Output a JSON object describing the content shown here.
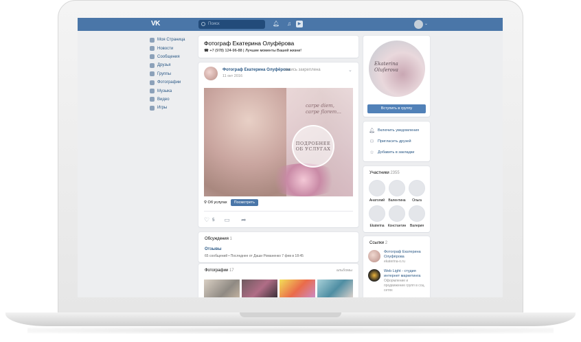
{
  "header": {
    "logo": "VK",
    "search_placeholder": "Поиск",
    "icons": [
      "bell-icon",
      "music-icon",
      "play-icon"
    ]
  },
  "nav": {
    "items": [
      {
        "label": "Моя Страница",
        "icon": "home-icon"
      },
      {
        "label": "Новости",
        "icon": "news-icon"
      },
      {
        "label": "Сообщения",
        "icon": "messages-icon"
      },
      {
        "label": "Друзья",
        "icon": "friends-icon"
      },
      {
        "label": "Группы",
        "icon": "groups-icon"
      },
      {
        "label": "Фотографии",
        "icon": "photos-icon"
      },
      {
        "label": "Музыка",
        "icon": "music-icon"
      },
      {
        "label": "Видео",
        "icon": "video-icon"
      },
      {
        "label": "Игры",
        "icon": "games-icon"
      }
    ]
  },
  "group": {
    "name": "Фотограф Екатерина Олуфёрова",
    "status": "☎ +7 (978) 124-96-88 | Лучшие моменты Вашей жизни!"
  },
  "post": {
    "author": "Фотограф Екатерина Олуфёрова",
    "pinned": "запись закреплена",
    "date": "11 окт 2016",
    "image_script": "carpe diem,\ncarpe florem...",
    "image_badge": "ПОДРОБНЕЕ\nОБ УСЛУГАХ",
    "link_label": "⚲ Об услугах",
    "link_button": "Посмотреть",
    "likes": "5"
  },
  "discussions": {
    "title": "Обсуждения",
    "count": "1",
    "topic": "Отзывы",
    "meta": "65 сообщений  •  Последнее от Даши Романенко 7 фев в 18:45"
  },
  "photos": {
    "title": "Фотографии",
    "count": "17",
    "albums": "альбомы"
  },
  "sidebar": {
    "cover_script": "Ekaterina\nOluferova",
    "join_button": "Вступить в группу",
    "actions": [
      {
        "label": "Включить уведомления",
        "icon": "bell-icon"
      },
      {
        "label": "Пригласить друзей",
        "icon": "add-user-icon"
      },
      {
        "label": "Добавить в закладки",
        "icon": "star-icon"
      }
    ],
    "members_title": "Участники",
    "members_count": "2355",
    "members": [
      "Анатолий",
      "Валентина",
      "Ольга",
      "Ekaterina",
      "Константин",
      "Валерия"
    ],
    "links_title": "Ссылки",
    "links_count": "2",
    "links": [
      {
        "title": "Фотограф Екатерина Олуфёрова",
        "sub": "ekaterina-o.ru"
      },
      {
        "title": "Web Light - студия интернет маркетинга",
        "sub": "Оформление и продвижение групп в соц. сетях"
      }
    ]
  },
  "colors": {
    "vk_blue": "#4a76a8",
    "button_blue": "#5181b8",
    "link_blue": "#2a5885",
    "page_bg": "#edeef0"
  }
}
